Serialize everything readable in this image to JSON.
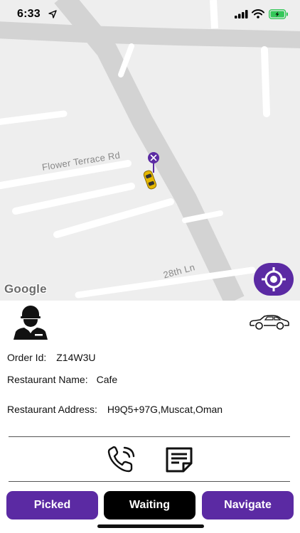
{
  "status_bar": {
    "time": "6:33"
  },
  "map": {
    "streets": [
      "Flower Terrace Rd",
      "28th Ln"
    ],
    "attribution": "Google"
  },
  "order": {
    "order_id_label": "Order Id:",
    "order_id": "Z14W3U",
    "restaurant_name_label": "Restaurant Name:",
    "restaurant_name": "Cafe",
    "restaurant_address_label": "Restaurant Address:",
    "restaurant_address": "H9Q5+97G,Muscat,Oman"
  },
  "actions": {
    "picked_label": "Picked",
    "waiting_label": "Waiting",
    "navigate_label": "Navigate"
  },
  "icons": [
    "location-arrow-icon",
    "signal-icon",
    "wifi-icon",
    "battery-icon",
    "restaurant-marker-icon",
    "car-marker-icon",
    "my-location-icon",
    "driver-icon",
    "car-icon",
    "phone-call-icon",
    "notes-icon"
  ],
  "colors": {
    "accent": "#5b2aa3",
    "active_button": "#000000",
    "battery": "#34c759"
  }
}
